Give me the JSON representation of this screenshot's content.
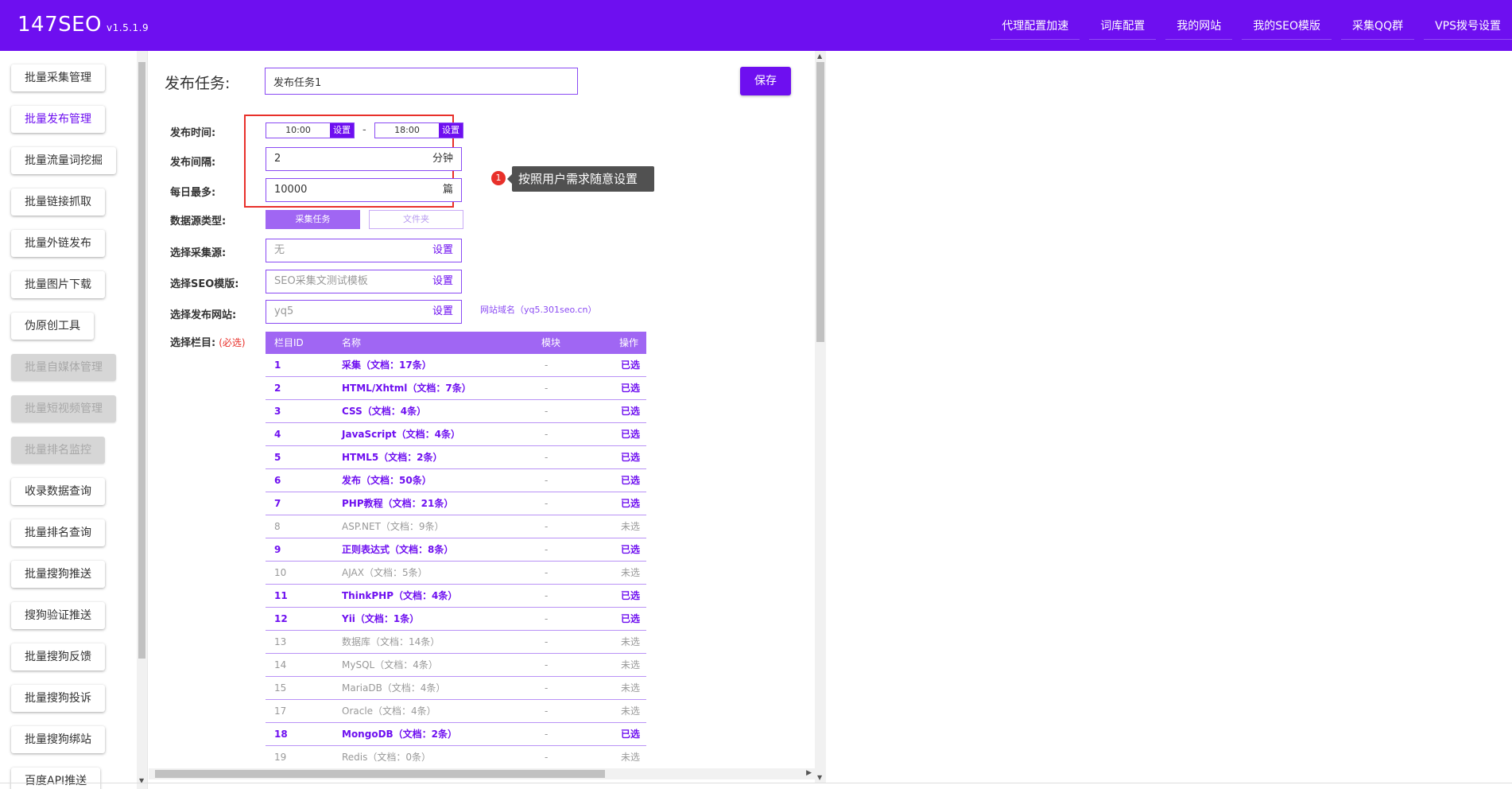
{
  "app": {
    "name": "147SEO",
    "version": "v1.5.1.9"
  },
  "topnav": [
    "代理配置加速",
    "词库配置",
    "我的网站",
    "我的SEO模版",
    "采集QQ群",
    "VPS拨号设置"
  ],
  "sidebar": [
    {
      "label": "批量采集管理",
      "state": "normal"
    },
    {
      "label": "批量发布管理",
      "state": "active"
    },
    {
      "label": "批量流量词挖掘",
      "state": "normal"
    },
    {
      "label": "批量链接抓取",
      "state": "normal"
    },
    {
      "label": "批量外链发布",
      "state": "normal"
    },
    {
      "label": "批量图片下载",
      "state": "normal"
    },
    {
      "label": "伪原创工具",
      "state": "normal"
    },
    {
      "label": "批量自媒体管理",
      "state": "disabled"
    },
    {
      "label": "批量短视频管理",
      "state": "disabled"
    },
    {
      "label": "批量排名监控",
      "state": "disabled"
    },
    {
      "label": "收录数据查询",
      "state": "normal"
    },
    {
      "label": "批量排名查询",
      "state": "normal"
    },
    {
      "label": "批量搜狗推送",
      "state": "normal"
    },
    {
      "label": "搜狗验证推送",
      "state": "normal"
    },
    {
      "label": "批量搜狗反馈",
      "state": "normal"
    },
    {
      "label": "批量搜狗投诉",
      "state": "normal"
    },
    {
      "label": "批量搜狗绑站",
      "state": "normal"
    },
    {
      "label": "百度API推送",
      "state": "normal"
    }
  ],
  "form": {
    "task_label": "发布任务:",
    "task_name": "发布任务1",
    "save_label": "保存",
    "publish_time_label": "发布时间:",
    "time_start": "10:00",
    "time_end": "18:00",
    "set_label": "设置",
    "time_separator": "-",
    "interval_label": "发布间隔:",
    "interval_value": "2",
    "interval_unit": "分钟",
    "daily_max_label": "每日最多:",
    "daily_max_value": "10000",
    "daily_max_unit": "篇",
    "datasource_label": "数据源类型:",
    "datasource_options": [
      "采集任务",
      "文件夹"
    ],
    "collect_source_label": "选择采集源:",
    "collect_source_value": "无",
    "seo_template_label": "选择SEO模版:",
    "seo_template_value": "SEO采集文测试模板",
    "site_label": "选择发布网站:",
    "site_value": "yq5",
    "site_domain_note": "网站域名（yq5.301seo.cn）",
    "column_label": "选择栏目:",
    "column_required": "(必选)"
  },
  "tooltip": {
    "number": "1",
    "text": "按照用户需求随意设置"
  },
  "table": {
    "headers": [
      "栏目ID",
      "名称",
      "模块",
      "操作"
    ],
    "rows": [
      {
        "id": "1",
        "name": "采集（文档：17条）",
        "module": "-",
        "op": "已选",
        "selected": true
      },
      {
        "id": "2",
        "name": "HTML/Xhtml（文档：7条）",
        "module": "-",
        "op": "已选",
        "selected": true
      },
      {
        "id": "3",
        "name": "CSS（文档：4条）",
        "module": "-",
        "op": "已选",
        "selected": true
      },
      {
        "id": "4",
        "name": "JavaScript（文档：4条）",
        "module": "-",
        "op": "已选",
        "selected": true
      },
      {
        "id": "5",
        "name": "HTML5（文档：2条）",
        "module": "-",
        "op": "已选",
        "selected": true
      },
      {
        "id": "6",
        "name": "发布（文档：50条）",
        "module": "-",
        "op": "已选",
        "selected": true
      },
      {
        "id": "7",
        "name": "PHP教程（文档：21条）",
        "module": "-",
        "op": "已选",
        "selected": true
      },
      {
        "id": "8",
        "name": "ASP.NET（文档：9条）",
        "module": "-",
        "op": "未选",
        "selected": false
      },
      {
        "id": "9",
        "name": "正则表达式（文档：8条）",
        "module": "-",
        "op": "已选",
        "selected": true
      },
      {
        "id": "10",
        "name": "AJAX（文档：5条）",
        "module": "-",
        "op": "未选",
        "selected": false
      },
      {
        "id": "11",
        "name": "ThinkPHP（文档：4条）",
        "module": "-",
        "op": "已选",
        "selected": true
      },
      {
        "id": "12",
        "name": "Yii（文档：1条）",
        "module": "-",
        "op": "已选",
        "selected": true
      },
      {
        "id": "13",
        "name": "数据库（文档：14条）",
        "module": "-",
        "op": "未选",
        "selected": false
      },
      {
        "id": "14",
        "name": "MySQL（文档：4条）",
        "module": "-",
        "op": "未选",
        "selected": false
      },
      {
        "id": "15",
        "name": "MariaDB（文档：4条）",
        "module": "-",
        "op": "未选",
        "selected": false
      },
      {
        "id": "17",
        "name": "Oracle（文档：4条）",
        "module": "-",
        "op": "未选",
        "selected": false
      },
      {
        "id": "18",
        "name": "MongoDB（文档：2条）",
        "module": "-",
        "op": "已选",
        "selected": true
      },
      {
        "id": "19",
        "name": "Redis（文档：0条）",
        "module": "-",
        "op": "未选",
        "selected": false
      }
    ]
  },
  "colors": {
    "brand": "#6e0ff0",
    "header_row": "#a066f3",
    "highlight": "#e8302a"
  }
}
